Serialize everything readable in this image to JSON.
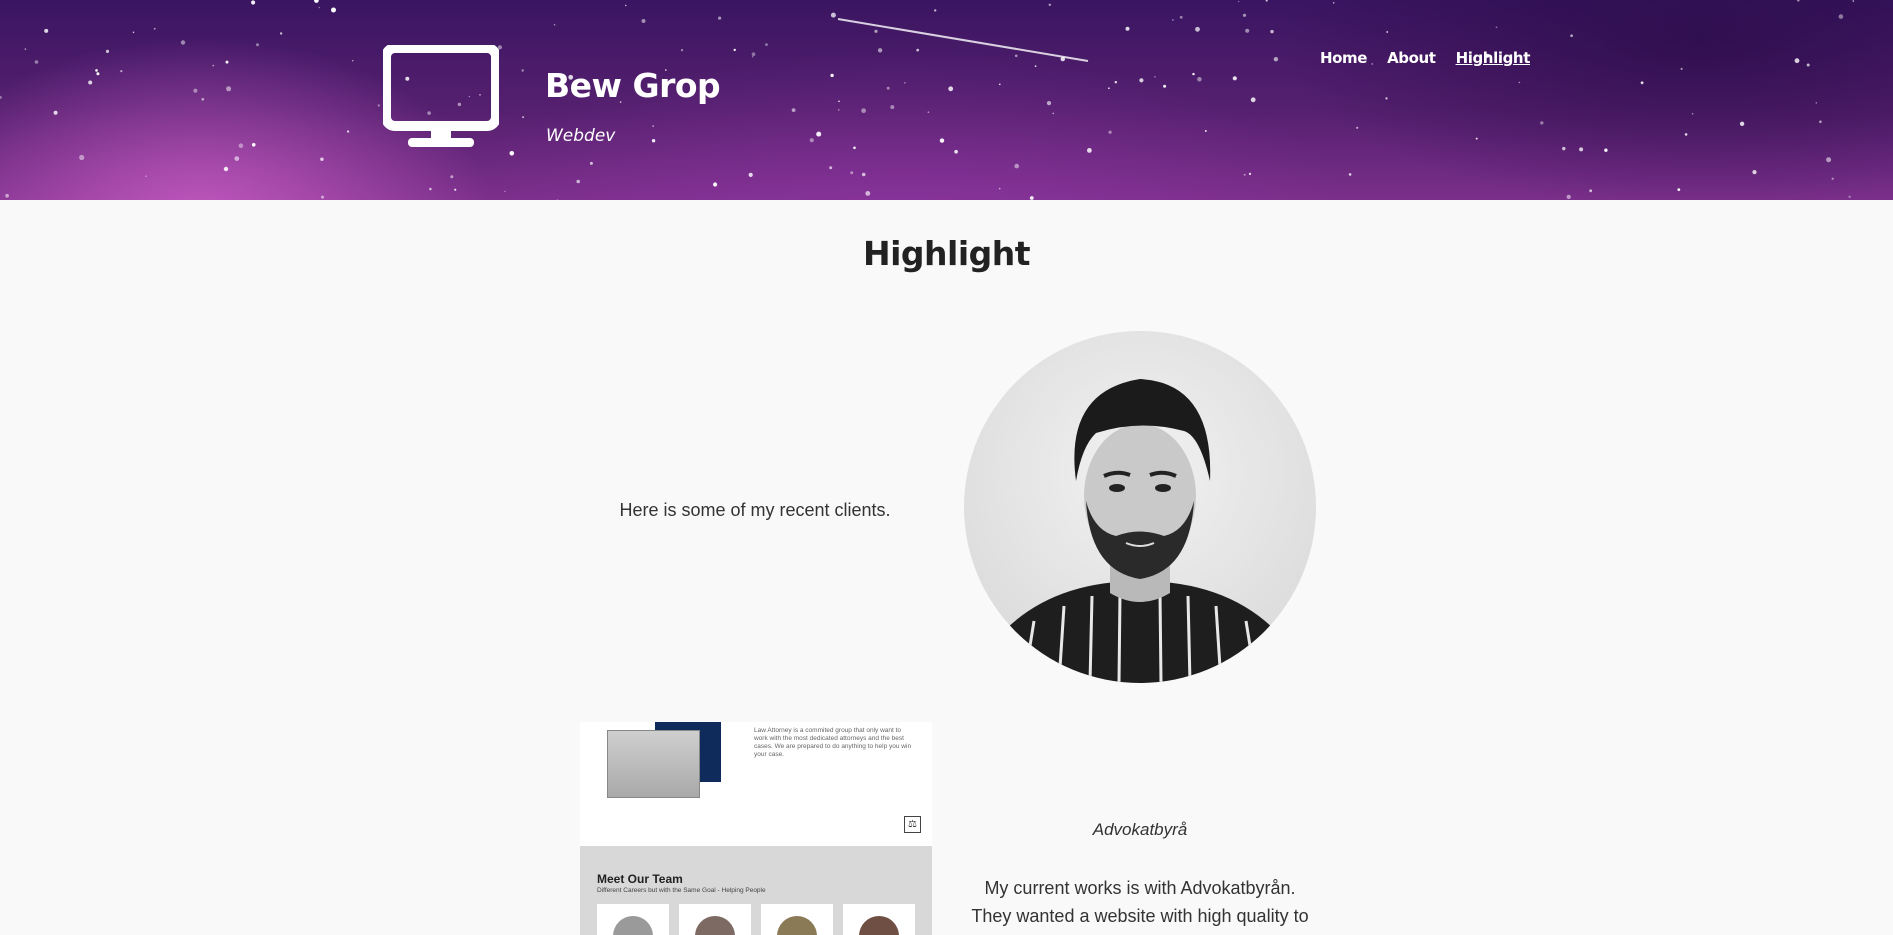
{
  "header": {
    "logo_icon": "desktop-monitor-icon",
    "title": "Bew Grop",
    "subtitle": "Webdev",
    "nav": [
      {
        "label": "Home",
        "active": false
      },
      {
        "label": "About",
        "active": false
      },
      {
        "label": "Highlight",
        "active": true
      }
    ]
  },
  "main": {
    "title": "Highlight",
    "intro": "Here is some of my recent clients.",
    "client": {
      "name": "Advokatbyrå",
      "description": "My current works is with Advokatbyrån. They wanted a website with high quality to show",
      "screenshot": {
        "blurb": "Law Attorney is a commited group that only want to work with the most dedicated attorneys and the best cases. We are prepared to do anything to help you win your case.",
        "team_title": "Meet Our Team",
        "team_subtitle": "Different Careers but with the Same Goal - Helping People",
        "scale_icon": "scale-of-justice-icon"
      }
    }
  },
  "colors": {
    "header_top": "#3a1561",
    "header_bottom": "#7a2f8a",
    "page_bg": "#f9f9f9",
    "text": "#222222"
  }
}
